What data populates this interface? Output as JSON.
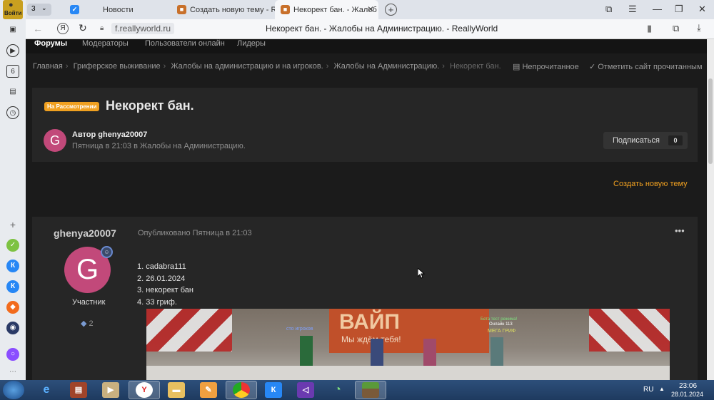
{
  "browser": {
    "profile_label": "Войти",
    "tab_count": "3",
    "tabs": [
      {
        "title": "Новости"
      },
      {
        "title": "Создать новую тему - Rea"
      },
      {
        "title": "Некорект бан. - Жалоб"
      }
    ],
    "address": "f.reallyworld.ru",
    "page_title": "Некорект бан. - Жалобы на Администрацию. - ReallyWorld"
  },
  "site_nav": [
    "Форумы",
    "Модераторы",
    "Пользователи онлайн",
    "Лидеры"
  ],
  "breadcrumb": [
    "Главная",
    "Гриферское выживание",
    "Жалобы на администрацию и на игроков.",
    "Жалобы на Администрацию.",
    "Некорект бан."
  ],
  "breadcrumb_actions": {
    "unread": "Непрочитанное",
    "mark_read": "Отметить сайт прочитанным"
  },
  "topic": {
    "status_badge": "На Рассмотрении",
    "title": "Некорект бан.",
    "author_line": "Автор ghenya20007",
    "avatar_letter": "G",
    "meta": "Пятница в 21:03 в Жалобы на Администрацию.",
    "subscribe_label": "Подписаться",
    "subscribe_count": "0",
    "new_topic_label": "Создать новую тему"
  },
  "post": {
    "username": "ghenya20007",
    "published": "Опубликовано Пятница в 21:03",
    "avatar_letter": "G",
    "role": "Участник",
    "posts_count": "2",
    "lines": [
      "1. cadabra111",
      "2. 26.01.2024",
      "3. некорект бан",
      "4. 33 гриф."
    ],
    "image": {
      "sign_big": "ВАЙП",
      "sign_small": "Мы ждём тебя!",
      "tag_left": "сто игроков",
      "tag_right_1": "Бета тест режима!",
      "tag_right_2": "Онлайн 113",
      "tag_right_3": "МЕГА ГРИФ"
    }
  },
  "taskbar": {
    "lang": "RU",
    "time": "23:06",
    "date": "28.01.2024"
  },
  "colors": {
    "accent": "#f0a020",
    "avatar": "#c2497a",
    "page_bg": "#1b1b1b",
    "card_bg": "#262626"
  }
}
